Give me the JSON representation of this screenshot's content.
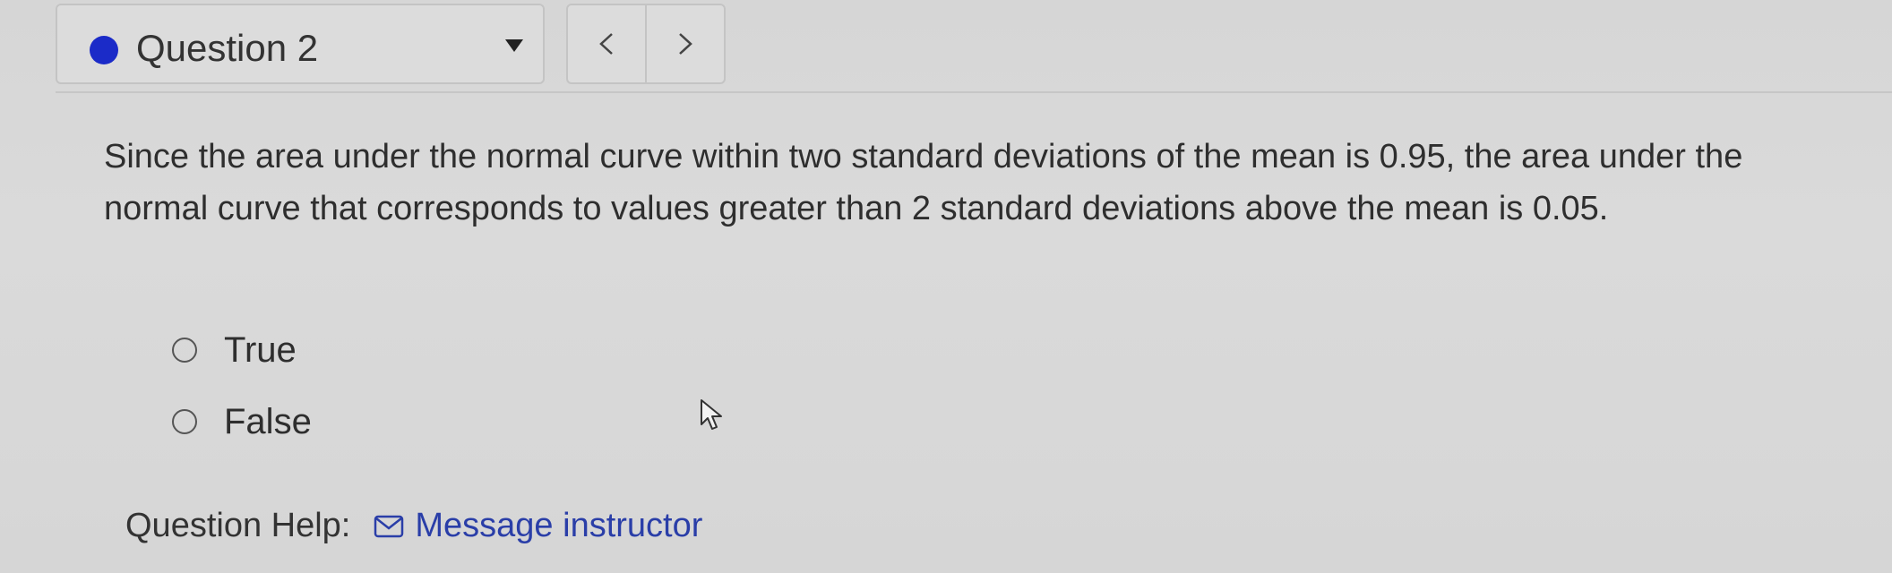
{
  "question_nav": {
    "selected_label": "Question 2",
    "status_color": "#1b2bc8",
    "dropdown_icon": "caret-down-icon",
    "prev_icon": "chevron-left-icon",
    "next_icon": "chevron-right-icon"
  },
  "question": {
    "text": "Since the area under the normal curve within two standard deviations of the mean is 0.95, the area under the normal curve that corresponds to values greater than 2 standard deviations above the mean is 0.05.",
    "options": [
      {
        "label": "True",
        "selected": false
      },
      {
        "label": "False",
        "selected": false
      }
    ]
  },
  "help": {
    "label": "Question Help:",
    "link_label": "Message instructor",
    "link_icon": "mail-icon",
    "link_color": "#2a3ea8"
  }
}
